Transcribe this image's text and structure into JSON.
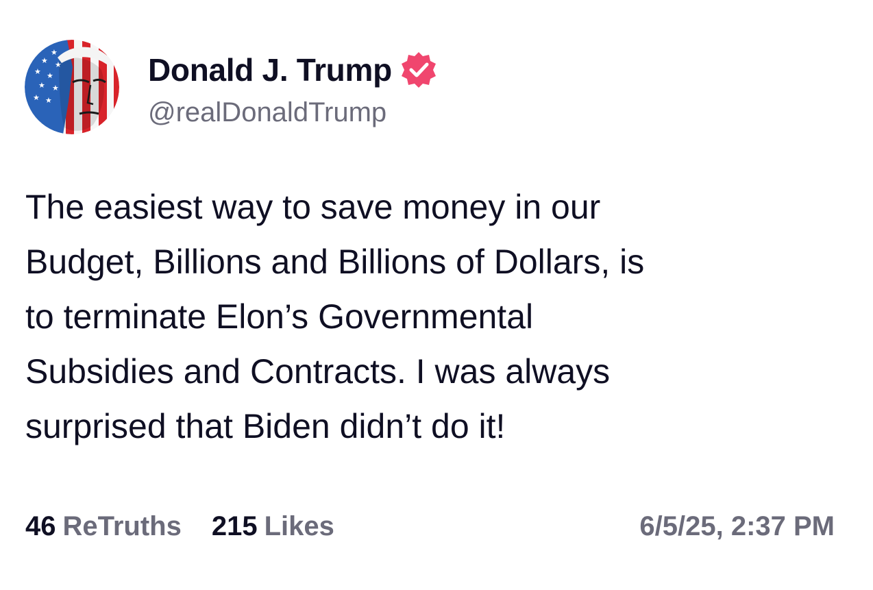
{
  "post": {
    "author": {
      "display_name": "Donald J. Trump",
      "handle": "@realDonaldTrump",
      "verified_icon": "verified-badge-icon",
      "verified_color": "#f0466e"
    },
    "body_lines": [
      "The easiest way to save money in our",
      "Budget, Billions and Billions of Dollars, is",
      "to terminate Elon’s Governmental",
      "Subsidies and Contracts. I was always",
      "surprised that Biden didn’t do it!"
    ],
    "stats": {
      "retruths_count": "46",
      "retruths_label": "ReTruths",
      "likes_count": "215",
      "likes_label": "Likes"
    },
    "timestamp": "6/5/25, 2:37 PM"
  }
}
